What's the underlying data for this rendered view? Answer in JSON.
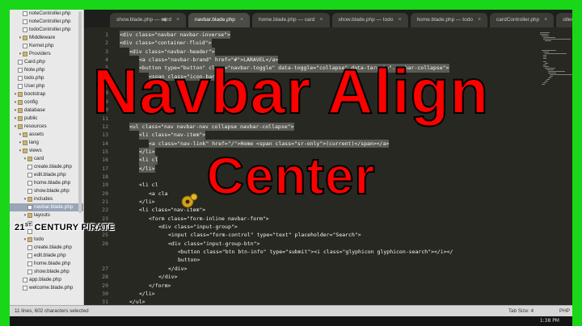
{
  "sidebar": {
    "items": [
      {
        "label": "noteController.php",
        "kind": "file",
        "indent": 1
      },
      {
        "label": "noteController.php",
        "kind": "file",
        "indent": 1
      },
      {
        "label": "todoController.php",
        "kind": "file",
        "indent": 1
      },
      {
        "label": "Middleware",
        "kind": "folder",
        "indent": 0
      },
      {
        "label": "Kernel.php",
        "kind": "file",
        "indent": 1
      },
      {
        "label": "Providers",
        "kind": "folder",
        "indent": 0
      },
      {
        "label": "Card.php",
        "kind": "file",
        "indent": 0
      },
      {
        "label": "Note.php",
        "kind": "file",
        "indent": 0
      },
      {
        "label": "todo.php",
        "kind": "file",
        "indent": 0
      },
      {
        "label": "User.php",
        "kind": "file",
        "indent": 0
      },
      {
        "label": "bootstrap",
        "kind": "folder",
        "indent": -1
      },
      {
        "label": "config",
        "kind": "folder",
        "indent": -1
      },
      {
        "label": "database",
        "kind": "folder",
        "indent": -1
      },
      {
        "label": "public",
        "kind": "folder",
        "indent": -1
      },
      {
        "label": "resources",
        "kind": "folder",
        "indent": -1
      },
      {
        "label": "assets",
        "kind": "folder",
        "indent": 0
      },
      {
        "label": "lang",
        "kind": "folder",
        "indent": 0
      },
      {
        "label": "views",
        "kind": "folder",
        "indent": 0
      },
      {
        "label": "card",
        "kind": "folder",
        "indent": 1
      },
      {
        "label": "create.blade.php",
        "kind": "file",
        "indent": 2
      },
      {
        "label": "edit.blade.php",
        "kind": "file",
        "indent": 2
      },
      {
        "label": "home.blade.php",
        "kind": "file",
        "indent": 2
      },
      {
        "label": "show.blade.php",
        "kind": "file",
        "indent": 2
      },
      {
        "label": "includes",
        "kind": "folder",
        "indent": 1
      },
      {
        "label": "navbar.blade.php",
        "kind": "file",
        "indent": 2,
        "selected": true
      },
      {
        "label": "layouts",
        "kind": "folder",
        "indent": 1
      },
      {
        "label": "",
        "kind": "file",
        "indent": 2
      },
      {
        "label": "",
        "kind": "file",
        "indent": 2
      },
      {
        "label": "todo",
        "kind": "folder",
        "indent": 1
      },
      {
        "label": "create.blade.php",
        "kind": "file",
        "indent": 2
      },
      {
        "label": "edit.blade.php",
        "kind": "file",
        "indent": 2
      },
      {
        "label": "home.blade.php",
        "kind": "file",
        "indent": 2
      },
      {
        "label": "show.blade.php",
        "kind": "file",
        "indent": 2
      },
      {
        "label": "app.blade.php",
        "kind": "file",
        "indent": 1
      },
      {
        "label": "welcome.blade.php",
        "kind": "file",
        "indent": 1
      }
    ]
  },
  "tabs": [
    {
      "label": "show.blade.php — card",
      "active": false
    },
    {
      "label": "navbar.blade.php",
      "active": true
    },
    {
      "label": "home.blade.php — card",
      "active": false
    },
    {
      "label": "show.blade.php — todo",
      "active": false
    },
    {
      "label": "home.blade.php — todo",
      "active": false
    },
    {
      "label": "cardController.php",
      "active": false
    },
    {
      "label": "oller.php",
      "active": false
    }
  ],
  "tab_close_glyph": "×",
  "editor": {
    "lines": [
      {
        "n": "1",
        "text": "<div class=\"navbar navbar-inverse\">",
        "indent": 0,
        "hl": true
      },
      {
        "n": "2",
        "text": "<div class=\"container-fluid\">",
        "indent": 0,
        "hl": true
      },
      {
        "n": "3",
        "text": "<div class=\"navbar-header\">",
        "indent": 2,
        "hl": true
      },
      {
        "n": "4",
        "text": "<a class=\"navbar-brand\" href=\"#\">LARAVEL</a>",
        "indent": 4,
        "hl": true
      },
      {
        "n": "5",
        "text": "<button type=\"button\" class=\"navbar-toggle\" data-toggle=\"collapse\" data-target=\".navbar-collapse\">",
        "indent": 4,
        "hl": true
      },
      {
        "n": "6",
        "text": "<span class=\"icon-bar\">",
        "indent": 6,
        "hl": true
      },
      {
        "n": "7",
        "text": "",
        "indent": 6,
        "hl": true
      },
      {
        "n": "8",
        "text": "",
        "indent": 6,
        "hl": true
      },
      {
        "n": "9",
        "text": "",
        "indent": 4,
        "hl": true
      },
      {
        "n": "10",
        "text": "",
        "indent": 2,
        "hl": true
      },
      {
        "n": "11",
        "text": "",
        "indent": 0,
        "hl": false
      },
      {
        "n": "12",
        "text": "<ul class=\"nav navbar-nav collapse navbar-collapse\">",
        "indent": 2,
        "hl": true
      },
      {
        "n": "13",
        "text": "<li class=\"nav-item\">",
        "indent": 4,
        "hl": true
      },
      {
        "n": "14",
        "text": "<a class=\"nav-link\" href=\"/\">Home <span class=\"sr-only\">(current)</span></a>",
        "indent": 6,
        "hl": true
      },
      {
        "n": "15",
        "text": "</li>",
        "indent": 4,
        "hl": true
      },
      {
        "n": "16",
        "text": "<li cl",
        "indent": 4,
        "hl": true
      },
      {
        "n": "17",
        "text": "</li>",
        "indent": 4,
        "hl": true
      },
      {
        "n": "18",
        "text": "",
        "indent": 4,
        "hl": true
      },
      {
        "n": "19",
        "text": "<li cl",
        "indent": 4,
        "hl": false
      },
      {
        "n": "20",
        "text": "<a cla",
        "indent": 6,
        "hl": false
      },
      {
        "n": "21",
        "text": "</li>",
        "indent": 4,
        "hl": false
      },
      {
        "n": "22",
        "text": "<li class=\"nav-item\">",
        "indent": 4,
        "hl": false
      },
      {
        "n": "23",
        "text": "<form class=\"form-inline navbar-form\">",
        "indent": 6,
        "hl": false
      },
      {
        "n": "24",
        "text": "<div class=\"input-group\">",
        "indent": 8,
        "hl": false
      },
      {
        "n": "25",
        "text": "<input class=\"form-control\" type=\"text\" placeholder=\"Search\">",
        "indent": 10,
        "hl": false
      },
      {
        "n": "26",
        "text": "<div class=\"input-group-btn\">",
        "indent": 10,
        "hl": false
      },
      {
        "n": "",
        "text": "<button class=\"btn btn-info\" type=\"submit\"><i class=\"glyphicon glyphicon-search\"></i></",
        "indent": 12,
        "hl": false
      },
      {
        "n": "",
        "text": "button>",
        "indent": 12,
        "hl": false
      },
      {
        "n": "27",
        "text": "</div>",
        "indent": 10,
        "hl": false
      },
      {
        "n": "28",
        "text": "</div>",
        "indent": 8,
        "hl": false
      },
      {
        "n": "29",
        "text": "</form>",
        "indent": 6,
        "hl": false
      },
      {
        "n": "30",
        "text": "</li>",
        "indent": 4,
        "hl": false
      },
      {
        "n": "31",
        "text": "</ul>",
        "indent": 2,
        "hl": false
      },
      {
        "n": "32",
        "text": "",
        "indent": 0,
        "hl": false
      }
    ]
  },
  "status": {
    "left": "11 lines, 602 characters selected",
    "tab_size": "Tab Size: 4",
    "syntax": "PHP"
  },
  "taskbar": {
    "clock": "1:38 PM"
  },
  "overlay": {
    "title_line1": "Navbar Align",
    "title_line2": "Center",
    "watermark_num": "21",
    "watermark_suffix": "ST",
    "watermark_rest": " CENTURY PIRATE"
  },
  "colors": {
    "frame": "#19d619",
    "overlay_text": "#ff0000",
    "editor_bg": "#272822",
    "selection": "#5a5b55"
  }
}
